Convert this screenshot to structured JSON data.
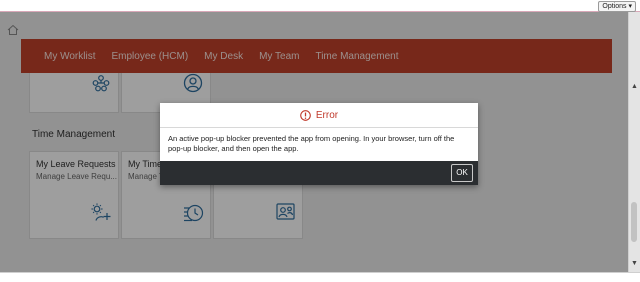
{
  "browser": {
    "options_label": "Options ▾"
  },
  "nav": {
    "tabs": [
      "My Worklist",
      "Employee (HCM)",
      "My Desk",
      "My Team",
      "Time Management"
    ]
  },
  "sections": {
    "time_management": {
      "title": "Time Management",
      "tiles": [
        {
          "title": "My Leave Requests",
          "subtitle": "Manage Leave Requ...",
          "icon": "person-sun-add-icon"
        },
        {
          "title": "My Time",
          "subtitle": "Manage T",
          "icon": "clock-list-icon"
        },
        {
          "title": "",
          "subtitle": "",
          "icon": "team-approval-icon"
        }
      ]
    },
    "top_tiles": [
      {
        "icon": "org-chart-icon"
      },
      {
        "icon": "user-circle-icon"
      }
    ]
  },
  "dialog": {
    "title": "Error",
    "message": "An active pop-up blocker prevented the app from opening. In your browser, turn off the pop-up blocker, and then open the app.",
    "ok_label": "OK"
  },
  "colors": {
    "nav_bar": "#c0412a",
    "error": "#c0392b",
    "dialog_footer": "#2b2e31",
    "icon_blue": "#2f6f9f"
  }
}
